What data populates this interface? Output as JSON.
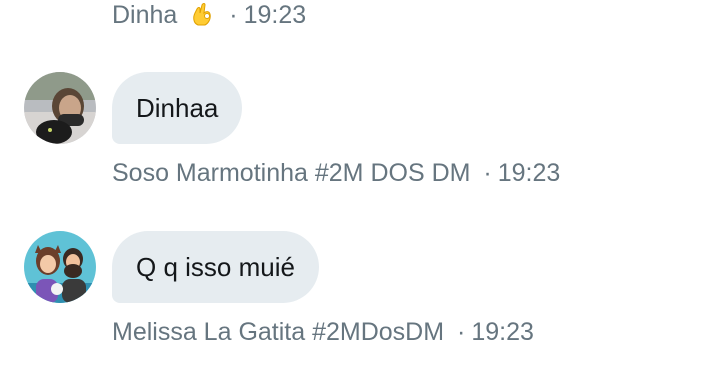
{
  "messages": [
    {
      "sender": "Dinha",
      "time": "19:23",
      "emoji": "ok-hand-emoji"
    },
    {
      "text": "Dinhaa",
      "sender": "Soso Marmotinha #2M DOS DM",
      "time": "19:23"
    },
    {
      "text": "Q q isso muié",
      "sender": "Melissa La Gatita #2MDosDM",
      "time": "19:23"
    }
  ],
  "separator": "·",
  "colors": {
    "bubble": "#e6ecf0",
    "meta_text": "#66757f",
    "message_text": "#14171a"
  }
}
